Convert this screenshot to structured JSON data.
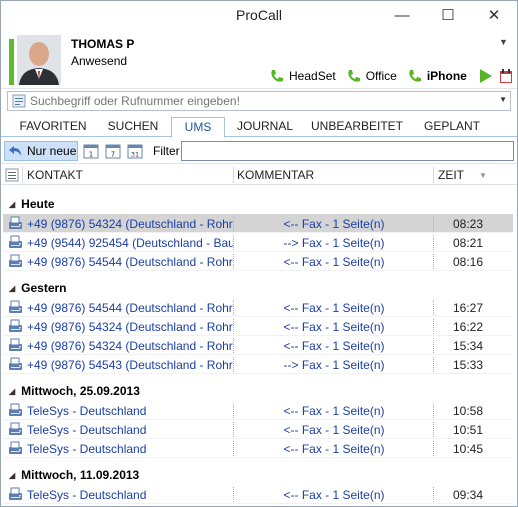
{
  "window": {
    "title": "ProCall",
    "minimize": "—",
    "maximize": "☐",
    "close": "✕"
  },
  "profile": {
    "name": "THOMAS P",
    "status": "Anwesend",
    "status_color": "#5dbb2e"
  },
  "devices": [
    {
      "label": "HeadSet",
      "active": false
    },
    {
      "label": "Office",
      "active": false
    },
    {
      "label": "iPhone",
      "active": true
    }
  ],
  "search": {
    "placeholder": "Suchbegriff oder Rufnummer eingeben!"
  },
  "tabs": [
    {
      "label": "FAVORITEN"
    },
    {
      "label": "SUCHEN"
    },
    {
      "label": "UMS",
      "active": true
    },
    {
      "label": "JOURNAL"
    },
    {
      "label": "UNBEARBEITET"
    },
    {
      "label": "GEPLANT"
    }
  ],
  "toolbar": {
    "new_only": "Nur neue",
    "filter_label": "Filter",
    "filter_value": ""
  },
  "columns": {
    "contact": "KONTAKT",
    "comment": "KOMMENTAR",
    "time": "ZEIT"
  },
  "groups": [
    {
      "label": "Heute",
      "rows": [
        {
          "contact": "+49 (9876) 54324 (Deutschland - Rohr ...",
          "comment": "<-- Fax - 1 Seite(n)",
          "time": "08:23",
          "selected": true
        },
        {
          "contact": "+49 (9544) 925454 (Deutschland - Bau...",
          "comment": "--> Fax - 1 Seite(n)",
          "time": "08:21"
        },
        {
          "contact": "+49 (9876) 54544 (Deutschland - Rohr ...",
          "comment": "<-- Fax - 1 Seite(n)",
          "time": "08:16"
        }
      ]
    },
    {
      "label": "Gestern",
      "rows": [
        {
          "contact": "+49 (9876) 54544 (Deutschland - Rohr ...",
          "comment": "<-- Fax - 1 Seite(n)",
          "time": "16:27"
        },
        {
          "contact": "+49 (9876) 54324 (Deutschland - Rohr ...",
          "comment": "<-- Fax - 1 Seite(n)",
          "time": "16:22"
        },
        {
          "contact": "+49 (9876) 54324 (Deutschland - Rohr ...",
          "comment": "<-- Fax - 1 Seite(n)",
          "time": "15:34"
        },
        {
          "contact": "+49 (9876) 54543 (Deutschland - Rohr ...",
          "comment": "--> Fax - 1 Seite(n)",
          "time": "15:33"
        }
      ]
    },
    {
      "label": "Mittwoch, 25.09.2013",
      "rows": [
        {
          "contact": "TeleSys - Deutschland",
          "comment": "<-- Fax - 1 Seite(n)",
          "time": "10:58"
        },
        {
          "contact": "TeleSys - Deutschland",
          "comment": "<-- Fax - 1 Seite(n)",
          "time": "10:51"
        },
        {
          "contact": "TeleSys - Deutschland",
          "comment": "<-- Fax - 1 Seite(n)",
          "time": "10:45"
        }
      ]
    },
    {
      "label": "Mittwoch, 11.09.2013",
      "rows": [
        {
          "contact": "TeleSys - Deutschland",
          "comment": "<-- Fax - 1 Seite(n)",
          "time": "09:34"
        }
      ]
    }
  ]
}
